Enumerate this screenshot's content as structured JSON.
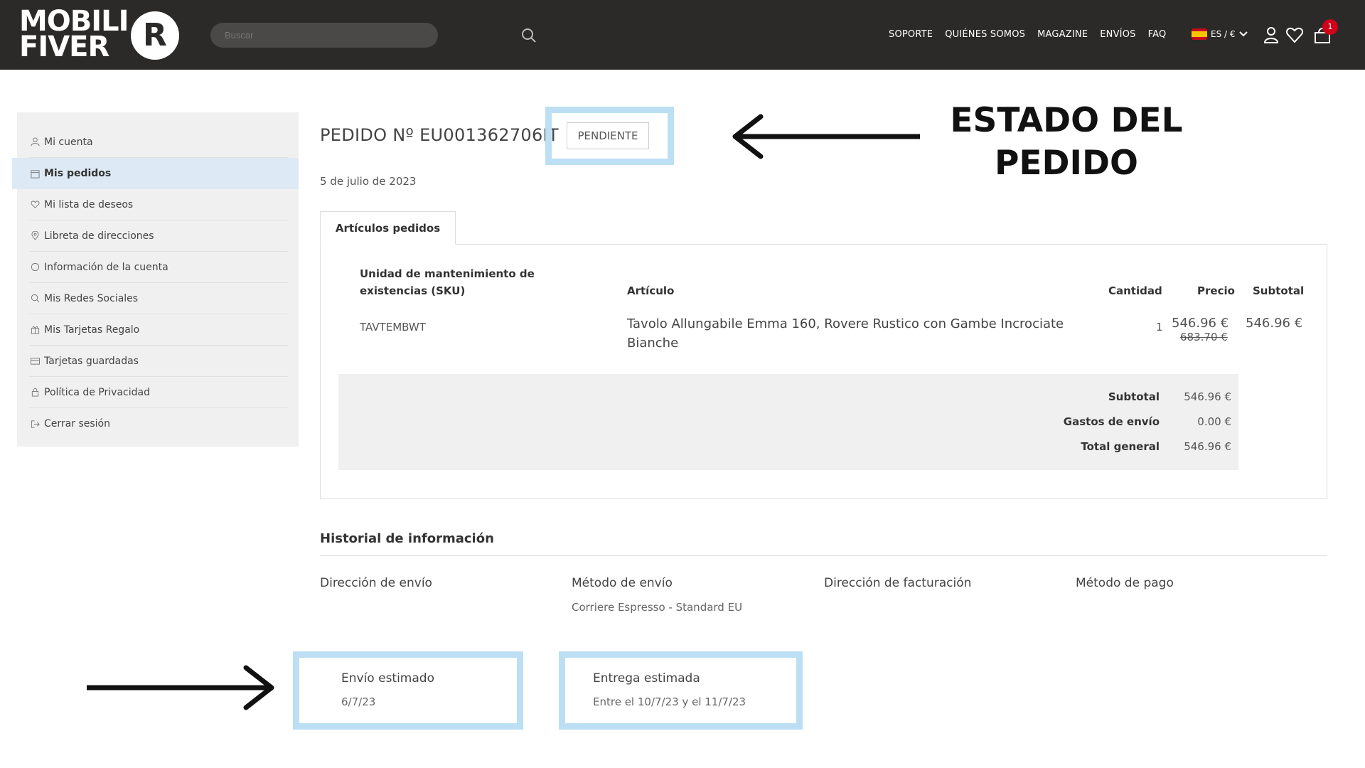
{
  "header": {
    "logo_line1": "MOBILI",
    "logo_line2": "FIVER",
    "logo_mark": "R",
    "search_placeholder": "Buscar",
    "nav": [
      "SOPORTE",
      "QUIÉNES SOMOS",
      "MAGAZINE",
      "ENVÍOS",
      "FAQ"
    ],
    "lang": "ES / €",
    "cart_count": "1"
  },
  "sidebar": {
    "items": [
      {
        "label": "Mi cuenta",
        "icon": "user-icon"
      },
      {
        "label": "Mis pedidos",
        "icon": "calendar-icon",
        "active": true
      },
      {
        "label": "Mi lista de deseos",
        "icon": "heart-icon"
      },
      {
        "label": "Libreta de direcciones",
        "icon": "map-pin-icon"
      },
      {
        "label": "Información de la cuenta",
        "icon": "circle-icon"
      },
      {
        "label": "Mis Redes Sociales",
        "icon": "search-icon"
      },
      {
        "label": "Mis Tarjetas Regalo",
        "icon": "gift-icon"
      },
      {
        "label": "Tarjetas guardadas",
        "icon": "card-icon"
      },
      {
        "label": "Política de Privacidad",
        "icon": "lock-icon"
      },
      {
        "label": "Cerrar sesión",
        "icon": "logout-icon"
      }
    ]
  },
  "order": {
    "title": "PEDIDO Nº EU001362706IT",
    "status": "PENDIENTE",
    "date": "5 de julio de 2023",
    "tab": "Artículos pedidos",
    "columns": {
      "sku": "Unidad de mantenimiento de existencias (SKU)",
      "article": "Artículo",
      "quantity": "Cantidad",
      "price": "Precio",
      "subtotal": "Subtotal"
    },
    "item": {
      "sku": "TAVTEMBWT",
      "name": "Tavolo Allungabile Emma 160, Rovere Rustico con Gambe Incrociate Bianche",
      "quantity": "1",
      "price": "546.96 €",
      "old_price": "683.70 €",
      "subtotal": "546.96 €"
    },
    "totals": [
      {
        "label": "Subtotal",
        "value": "546.96 €"
      },
      {
        "label": "Gastos de envío",
        "value": "0.00 €"
      },
      {
        "label": "Total general",
        "value": "546.96 €"
      }
    ]
  },
  "history": {
    "title": "Historial de información",
    "shipping_address_label": "Dirección de envío",
    "shipping_method_label": "Método de envío",
    "shipping_method_value": "Corriere Espresso - Standard EU",
    "billing_address_label": "Dirección de facturación",
    "payment_method_label": "Método de pago"
  },
  "estimates": {
    "ship_label": "Envío estimado",
    "ship_value": "6/7/23",
    "delivery_label": "Entrega estimada",
    "delivery_value": "Entre el 10/7/23 y el 11/7/23"
  },
  "annotation": {
    "line1": "ESTADO DEL",
    "line2": "PEDIDO"
  },
  "colors": {
    "header_bg": "#2b2a29",
    "highlight": "#bcdff3",
    "active_item": "#dde9f4",
    "badge": "#d0021b"
  }
}
